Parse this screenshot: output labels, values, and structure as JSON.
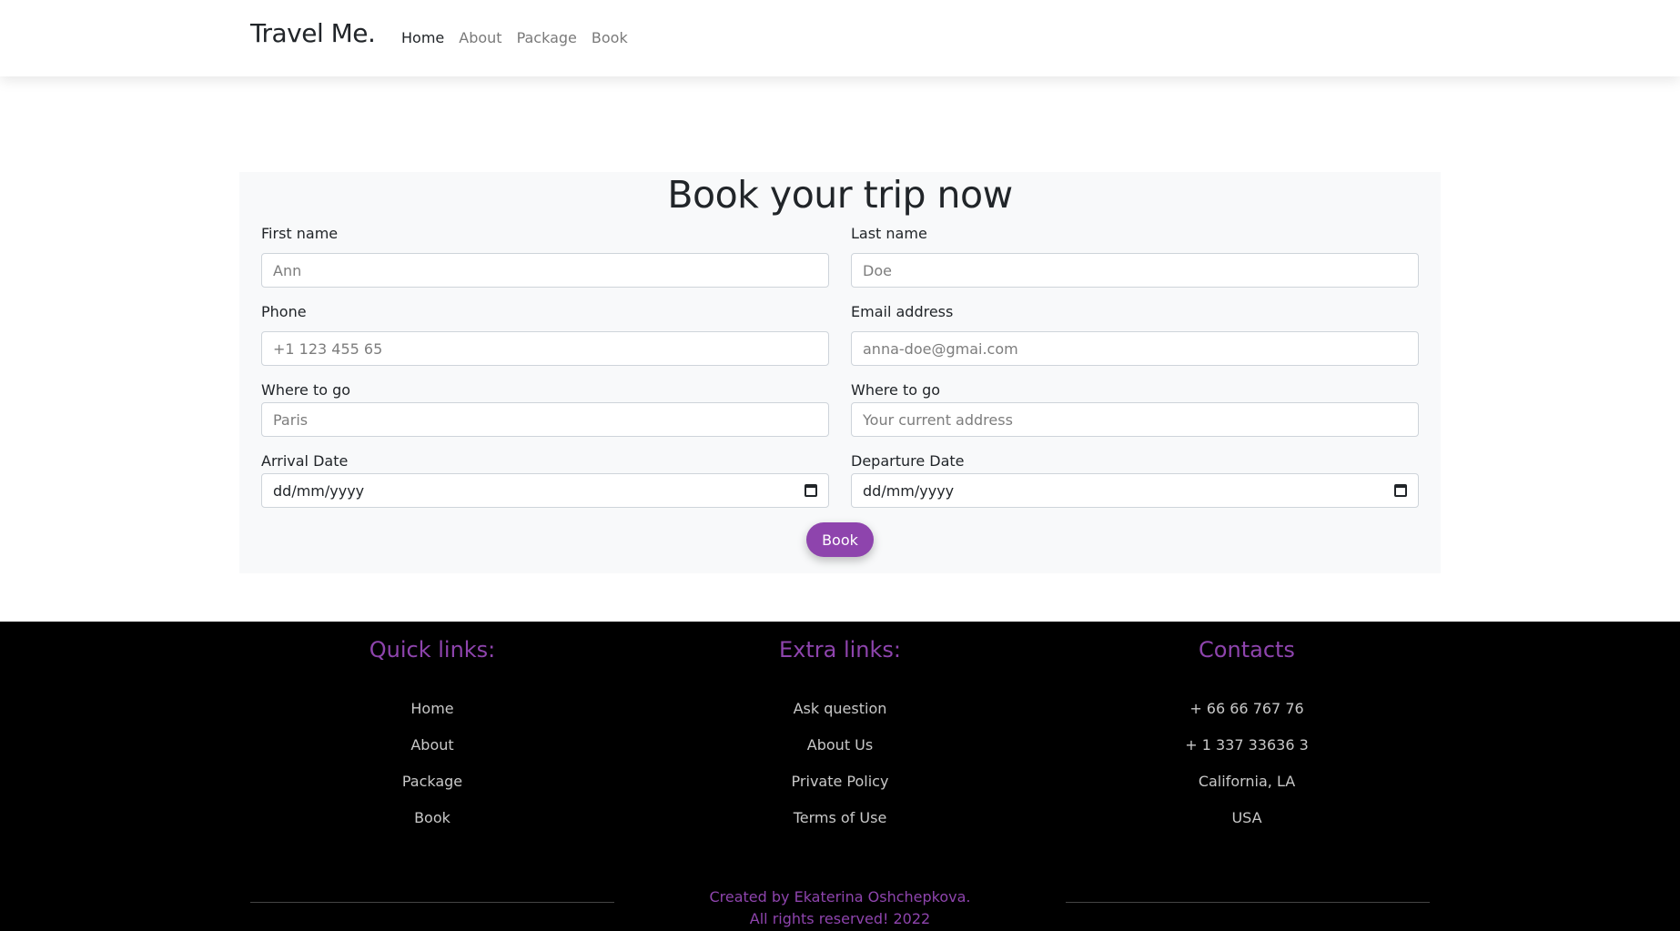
{
  "nav": {
    "brand": "Travel Me.",
    "links": [
      "Home",
      "About",
      "Package",
      "Book"
    ],
    "active": "Home"
  },
  "booking": {
    "title": "Book your trip now",
    "first_name": {
      "label": "First name",
      "placeholder": "Ann"
    },
    "last_name": {
      "label": "Last name",
      "placeholder": "Doe"
    },
    "phone": {
      "label": "Phone",
      "placeholder": "+1 123 455 65"
    },
    "email": {
      "label": "Email address",
      "placeholder": "anna-doe@gmai.com"
    },
    "destination": {
      "label": "Where to go",
      "placeholder": "Paris"
    },
    "origin": {
      "label": "Where to go",
      "placeholder": "Your current address"
    },
    "arrival": {
      "label": "Arrival Date",
      "value": "dd/mm/yyyy"
    },
    "departure": {
      "label": "Departure Date",
      "value": "dd/mm/yyyy"
    },
    "submit_label": "Book",
    "accent_color": "#8e44ad"
  },
  "footer": {
    "quick": {
      "title": "Quick links:",
      "items": [
        "Home",
        "About",
        "Package",
        "Book"
      ]
    },
    "extra": {
      "title": "Extra links:",
      "items": [
        "Ask question",
        "About Us",
        "Private Policy",
        "Terms of Use"
      ]
    },
    "contacts": {
      "title": "Contacts",
      "items": [
        "+ 66 66 767 76",
        "+ 1 337 33636 3",
        "California, LA",
        "USA"
      ]
    },
    "credits_line1": "Created by Ekaterina Oshchepkova.",
    "credits_line2": "All rights reserved! 2022"
  }
}
